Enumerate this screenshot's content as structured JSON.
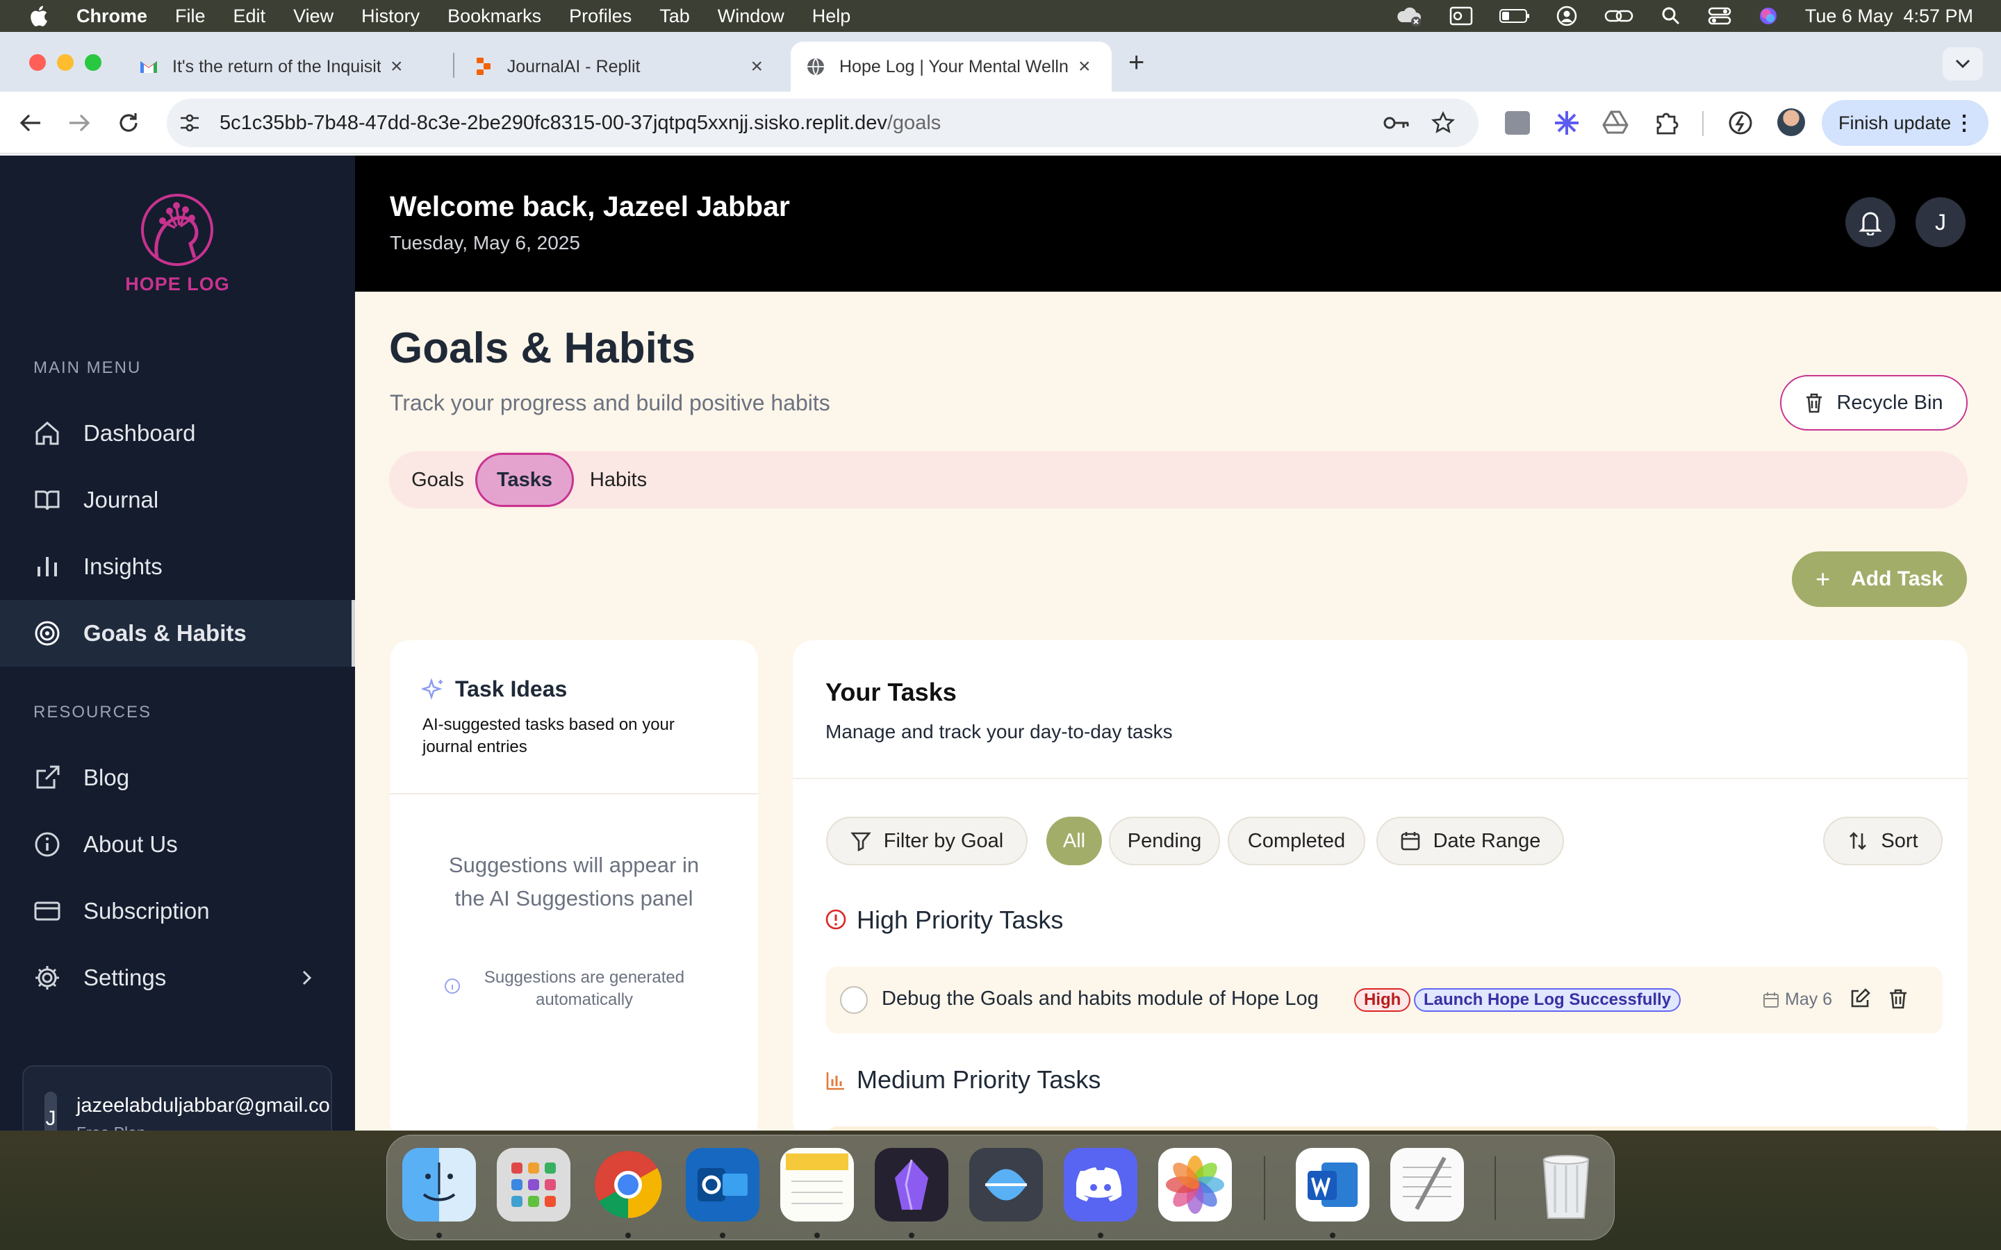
{
  "menubar": {
    "app_name": "Chrome",
    "menus": [
      "File",
      "Edit",
      "View",
      "History",
      "Bookmarks",
      "Profiles",
      "Tab",
      "Window",
      "Help"
    ],
    "datetime": "Tue 6 May  4:57 PM"
  },
  "browser": {
    "tabs": [
      {
        "title": "It's the return of the Inquisition",
        "icon": "gmail-icon"
      },
      {
        "title": "JournalAI - Replit",
        "icon": "replit-icon"
      },
      {
        "title": "Hope Log | Your Mental Wellness",
        "icon": "globe-icon"
      }
    ],
    "url_main": "5c1c35bb-7b48-47dd-8c3e-2be290fc8315-00-37jqtpq5xxnjj.sisko.replit.dev",
    "url_path": "/goals",
    "finish_update": "Finish update"
  },
  "sidebar": {
    "brand": "HOPE LOG",
    "main_menu_label": "MAIN MENU",
    "main_items": [
      {
        "label": "Dashboard",
        "icon": "home-icon"
      },
      {
        "label": "Journal",
        "icon": "book-icon"
      },
      {
        "label": "Insights",
        "icon": "bar-chart-icon"
      },
      {
        "label": "Goals & Habits",
        "icon": "target-icon",
        "active": true
      }
    ],
    "resources_label": "RESOURCES",
    "resource_items": [
      {
        "label": "Blog",
        "icon": "external-link-icon"
      },
      {
        "label": "About Us",
        "icon": "info-icon"
      },
      {
        "label": "Subscription",
        "icon": "card-icon"
      },
      {
        "label": "Settings",
        "icon": "gear-icon"
      }
    ],
    "user": {
      "initial": "J",
      "email": "jazeelabduljabbar@gmail.com",
      "plan": "Free Plan"
    }
  },
  "header": {
    "welcome": "Welcome back, Jazeel Jabbar",
    "date": "Tuesday, May 6, 2025",
    "avatar_initial": "J"
  },
  "page": {
    "title": "Goals & Habits",
    "subtitle": "Track your progress and build positive habits",
    "recycle_bin": "Recycle Bin",
    "tabs": [
      "Goals",
      "Tasks",
      "Habits"
    ],
    "active_tab": "Tasks",
    "add_task": "Add Task"
  },
  "ideas": {
    "title": "Task Ideas",
    "subtitle": "AI-suggested tasks based on your journal entries",
    "empty": "Suggestions will appear in the AI Suggestions panel",
    "note": "Suggestions are generated automatically"
  },
  "tasks": {
    "title": "Your Tasks",
    "subtitle": "Manage and track your day-to-day tasks",
    "filters": {
      "filter_by_goal": "Filter by Goal",
      "all": "All",
      "pending": "Pending",
      "completed": "Completed",
      "date_range": "Date Range",
      "sort": "Sort"
    },
    "groups": [
      {
        "title": "High Priority Tasks",
        "items": [
          {
            "title": "Debug the Goals and habits module of Hope Log",
            "priority": "High",
            "goal": "Launch Hope Log Successfully",
            "date": "May 6"
          }
        ]
      },
      {
        "title": "Medium Priority Tasks",
        "items": []
      }
    ]
  },
  "colors": {
    "accent_pink": "#c8338f",
    "olive": "#a3ad6a",
    "sidebar_bg": "#141c2e",
    "cream": "#fdf6ea"
  },
  "dock": [
    "finder-icon",
    "launchpad-icon",
    "chrome-icon",
    "outlook-icon",
    "notes-icon",
    "obsidian-icon",
    "migration-icon",
    "discord-icon",
    "photos-icon",
    "word-icon",
    "textedit-icon",
    "trash-icon"
  ]
}
